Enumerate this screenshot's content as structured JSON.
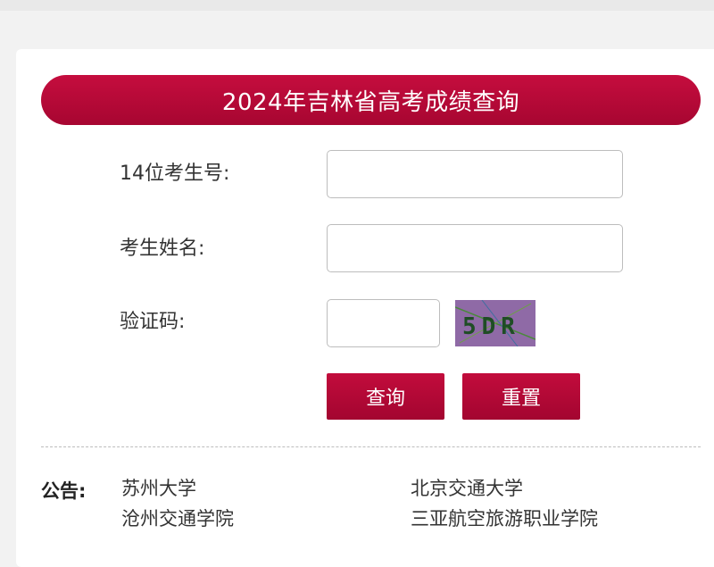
{
  "page": {
    "title": "2024年吉林省高考成绩查询"
  },
  "form": {
    "exam_id_label": "14位考生号:",
    "exam_id_value": "",
    "name_label": "考生姓名:",
    "name_value": "",
    "captcha_label": "验证码:",
    "captcha_value": "",
    "captcha_image_text": "5DR"
  },
  "buttons": {
    "query": "查询",
    "reset": "重置"
  },
  "notice": {
    "label": "公告:",
    "links": [
      "苏州大学",
      "北京交通大学",
      "沧州交通学院",
      "三亚航空旅游职业学院"
    ]
  },
  "colors": {
    "accent": "#b50a37",
    "captcha_bg": "#8f6aa6",
    "captcha_text": "#1f4d25"
  }
}
